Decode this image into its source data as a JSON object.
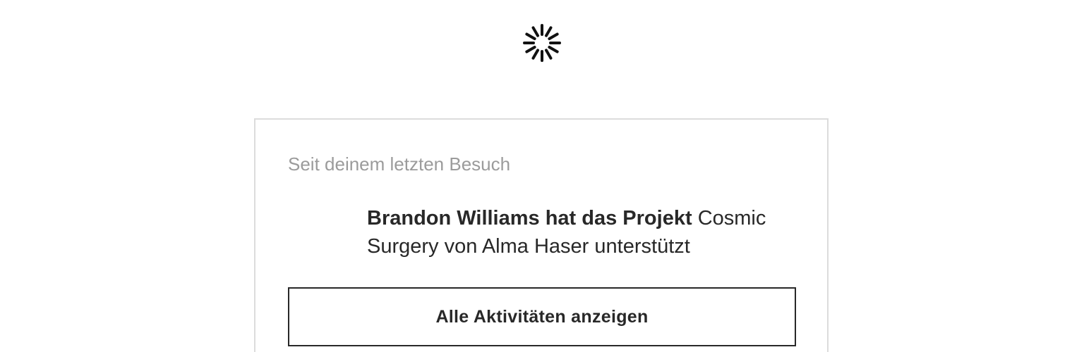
{
  "loading": {
    "icon": "spinner-icon",
    "color": "#111111"
  },
  "activity_card": {
    "heading": "Seit deinem letzten Besuch",
    "items": [
      {
        "actor_action": "Brandon Williams hat das Projekt",
        "project": "Cosmic Surgery",
        "connector": "von",
        "creator": "Alma Haser",
        "verb": "unterstützt"
      }
    ],
    "button_label": "Alle Aktivitäten anzeigen"
  },
  "colors": {
    "text": "#282828",
    "muted": "#9b9b9b",
    "border": "#dcdcdc"
  }
}
